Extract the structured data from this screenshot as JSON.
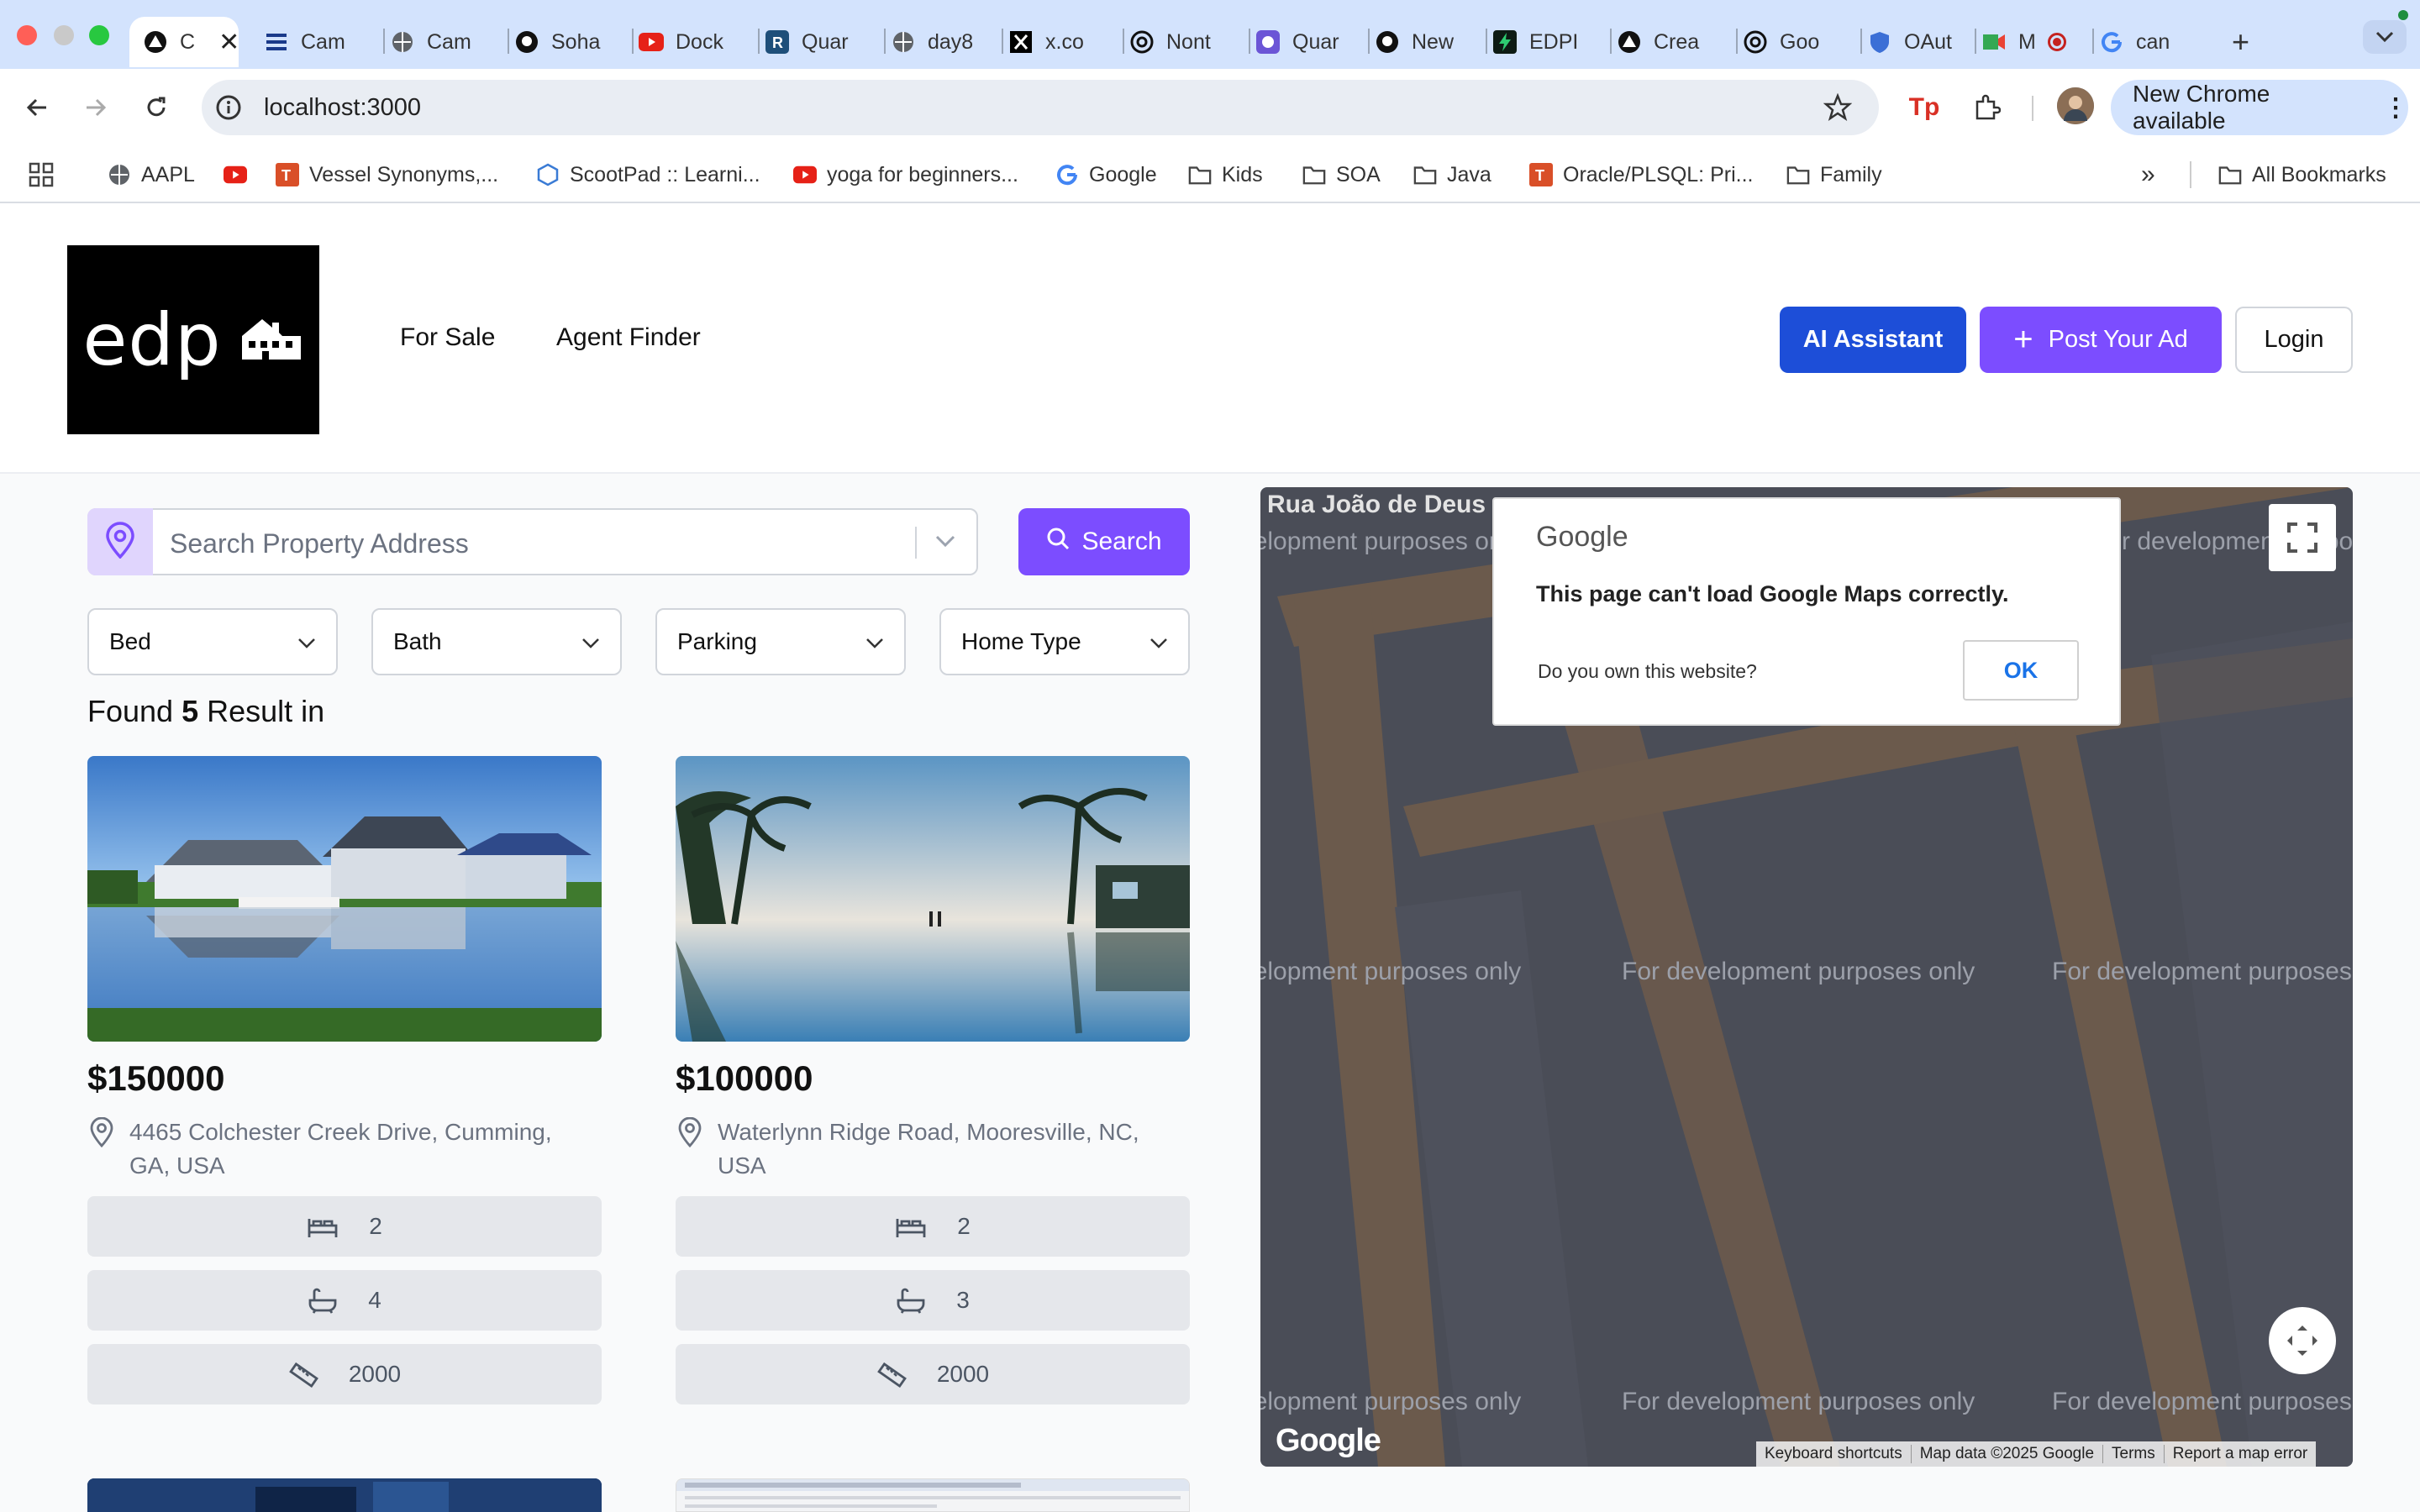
{
  "browser": {
    "tabs": [
      {
        "label": "C",
        "icon": "triangle-icon",
        "active": true
      },
      {
        "label": "Cam",
        "icon": "bars-icon"
      },
      {
        "label": "Cam",
        "icon": "globe-icon"
      },
      {
        "label": "Soha",
        "icon": "github-icon"
      },
      {
        "label": "Dock",
        "icon": "youtube-icon"
      },
      {
        "label": "Quar",
        "icon": "r-icon"
      },
      {
        "label": "day8",
        "icon": "globe-icon"
      },
      {
        "label": "x.co",
        "icon": "x-icon"
      },
      {
        "label": "Nont",
        "icon": "openai-icon"
      },
      {
        "label": "Quar",
        "icon": "quarto-icon"
      },
      {
        "label": "New",
        "icon": "github-icon"
      },
      {
        "label": "EDPI",
        "icon": "bolt-icon"
      },
      {
        "label": "Crea",
        "icon": "triangle-icon"
      },
      {
        "label": "Goo",
        "icon": "openai-icon"
      },
      {
        "label": "OAut",
        "icon": "shield-icon"
      },
      {
        "label": "M",
        "icon": "meet-icon"
      },
      {
        "label": "can",
        "icon": "google-icon"
      }
    ],
    "new_tab_label": "+",
    "url": "localhost:3000",
    "update_label": "New Chrome available",
    "bookmarks": [
      {
        "label": "AAPL",
        "icon": "globe-icon"
      },
      {
        "label": "",
        "icon": "youtube-icon"
      },
      {
        "label": "Vessel Synonyms,...",
        "icon": "t-icon"
      },
      {
        "label": "ScootPad :: Learni...",
        "icon": "scootpad-icon"
      },
      {
        "label": "yoga for beginners...",
        "icon": "youtube-icon"
      },
      {
        "label": "Google",
        "icon": "google-icon"
      },
      {
        "label": "Kids",
        "icon": "folder-icon"
      },
      {
        "label": "SOA",
        "icon": "folder-icon"
      },
      {
        "label": "Java",
        "icon": "folder-icon"
      },
      {
        "label": "Oracle/PLSQL: Pri...",
        "icon": "t-icon"
      },
      {
        "label": "Family",
        "icon": "folder-icon"
      }
    ],
    "all_bookmarks_label": "All Bookmarks",
    "overflow_label": "»"
  },
  "site": {
    "logo_text": "edp",
    "nav": [
      "For Sale",
      "Agent Finder"
    ],
    "ai_button": "AI Assistant",
    "post_button": "Post Your Ad",
    "post_icon": "+",
    "login_button": "Login"
  },
  "search": {
    "placeholder": "Search Property Address",
    "button": "Search"
  },
  "filters": [
    "Bed",
    "Bath",
    "Parking",
    "Home Type"
  ],
  "results": {
    "prefix": "Found",
    "count": "5",
    "suffix": "Result in"
  },
  "listings": [
    {
      "price": "$150000",
      "address": "4465 Colchester Creek Drive, Cumming, GA, USA",
      "beds": "2",
      "baths": "4",
      "area": "2000"
    },
    {
      "price": "$100000",
      "address": "Waterlynn Ridge Road, Mooresville, NC, USA",
      "beds": "2",
      "baths": "3",
      "area": "2000"
    }
  ],
  "map": {
    "street_label": "Rua João de Deus",
    "watermark": "For development purposes only",
    "dialog_brand": "Google",
    "dialog_message": "This page can't load Google Maps correctly.",
    "dialog_question": "Do you own this website?",
    "dialog_ok": "OK",
    "google_logo": "Google",
    "attribution": [
      "Keyboard shortcuts",
      "Map data ©2025 Google",
      "Terms",
      "Report a map error"
    ]
  },
  "colors": {
    "primary_blue": "#1d4ed8",
    "purple": "#7c4dff",
    "map_bg": "#4a4d57"
  }
}
